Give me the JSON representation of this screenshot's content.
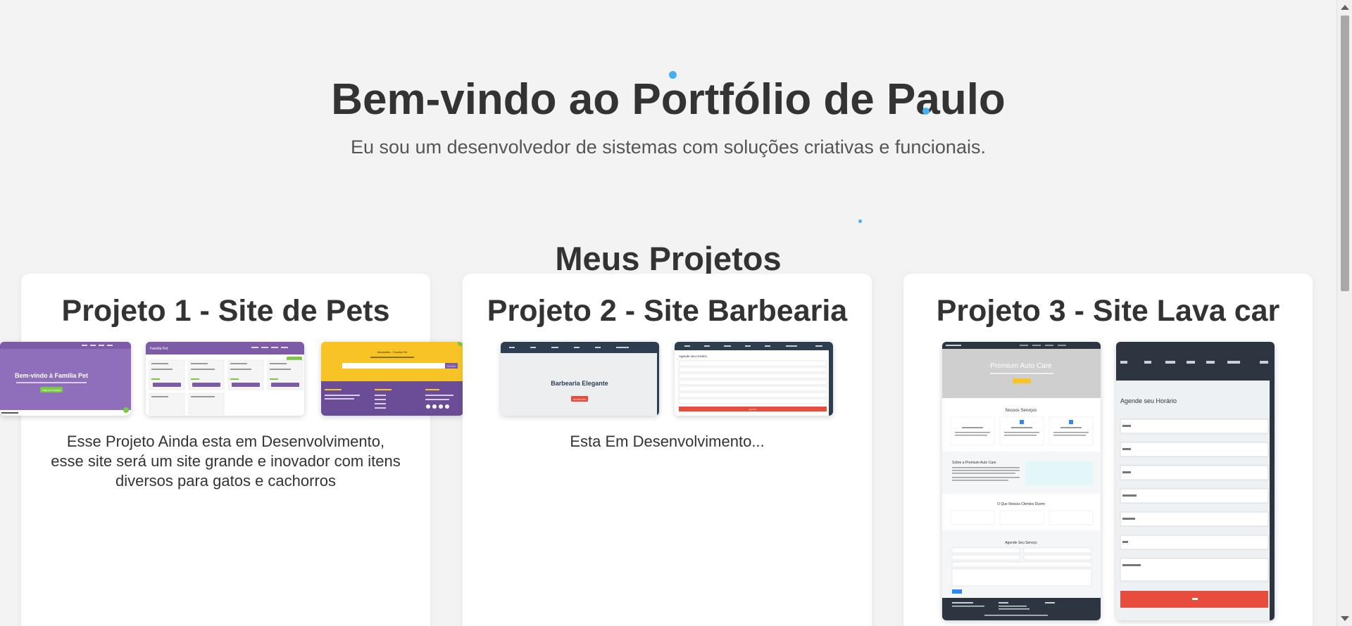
{
  "hero": {
    "title": "Bem-vindo ao Portfólio de Paulo",
    "subtitle": "Eu sou um desenvolvedor de sistemas com soluções criativas e funcionais."
  },
  "projects_section": {
    "title": "Meus Projetos",
    "projects": [
      {
        "title": "Projeto 1 - Site de Pets",
        "description": "Esse Projeto Ainda esta em Desenvolvimento, esse site será um site grande e inovador com itens diversos para gatos e cachorros",
        "screenshot_texts": {
          "hero_heading": "Bem-vindo à Família Pet",
          "hero_button": "Veja os Produtos",
          "brand": "Família Pet",
          "banner_title": "Newsletter - Família Pet",
          "banner_button": "Inscrever"
        }
      },
      {
        "title": "Projeto 2 - Site Barbearia",
        "description": "Esta Em Desenvolvimento...",
        "screenshot_texts": {
          "hero_heading": "Barbearia Elegante",
          "hero_button": "Agendar Agora",
          "form_heading": "Agende seu Horário",
          "form_button": "Agendar"
        }
      },
      {
        "title": "Projeto 3 - Site Lava car",
        "description": "",
        "screenshot_texts": {
          "hero_heading": "Premium Auto Care",
          "services_heading": "Nossos Serviços",
          "about_heading": "Sobre a Premium Auto Care",
          "testimonials_heading": "O Que Nossos Clientes Dizem",
          "schedule_heading": "Agende Seu Serviço",
          "form_heading": "Agende seu Horário"
        }
      }
    ]
  },
  "colors": {
    "background": "#f3f3f3",
    "card": "#ffffff",
    "text": "#333333",
    "accent_dot": "#44b0ef",
    "pet_purple": "#7d5ba6",
    "pet_yellow": "#f7c325",
    "pet_green": "#7ac943",
    "barber_dark": "#2c3e50",
    "barber_red": "#e74c3c",
    "lavacar_dark": "#2d3640",
    "lavacar_blue": "#2d89ef"
  }
}
